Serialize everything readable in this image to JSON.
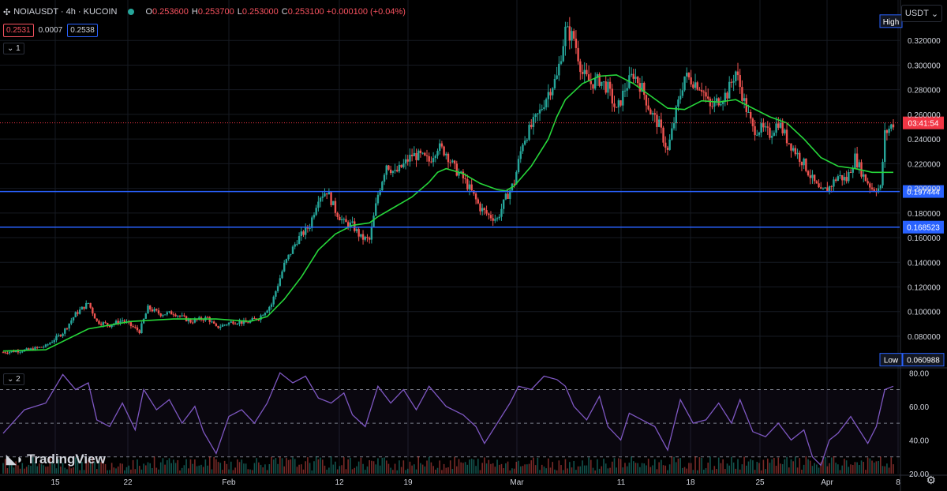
{
  "header": {
    "symbol": "NOIAUSDT · 4h · KUCOIN",
    "o_label": "O",
    "o_value": "0.253600",
    "h_label": "H",
    "h_value": "0.253700",
    "l_label": "L",
    "l_value": "0.253000",
    "c_label": "C",
    "c_value": "0.253100 +0.000100 (+0.04%)",
    "bid": "0.2531",
    "spread": "0.0007",
    "ask": "0.2538",
    "pane1_tag": "1",
    "pane2_tag": "2",
    "currency": "USDT",
    "brand": "TradingView"
  },
  "colors": {
    "up": "#26a69a",
    "down": "#ef5350",
    "ma": "#26d63a",
    "rsi": "#7e57c2",
    "hline": "#2962ff",
    "price_line": "#f23645"
  },
  "chart_data": [
    {
      "type": "line",
      "subtype": "candlestick",
      "ylim": [
        0.055,
        0.34
      ],
      "yticks": [
        "0.320000",
        "0.300000",
        "0.280000",
        "0.260000",
        "0.240000",
        "0.220000",
        "0.200000",
        "0.180000",
        "0.160000",
        "0.140000",
        "0.120000",
        "0.100000",
        "0.080000"
      ],
      "xticks": [
        "15",
        "22",
        "Feb",
        "12",
        "19",
        "Mar",
        "11",
        "18",
        "25",
        "Apr",
        "8"
      ],
      "price_path": [
        [
          0,
          0.067
        ],
        [
          6,
          0.069
        ],
        [
          10,
          0.072
        ],
        [
          14,
          0.083
        ],
        [
          17,
          0.098
        ],
        [
          20,
          0.107
        ],
        [
          22,
          0.092
        ],
        [
          25,
          0.089
        ],
        [
          28,
          0.093
        ],
        [
          32,
          0.084
        ],
        [
          34,
          0.103
        ],
        [
          37,
          0.098
        ],
        [
          40,
          0.099
        ],
        [
          44,
          0.092
        ],
        [
          48,
          0.095
        ],
        [
          50,
          0.087
        ],
        [
          54,
          0.092
        ],
        [
          57,
          0.091
        ],
        [
          60,
          0.095
        ],
        [
          63,
          0.106
        ],
        [
          66,
          0.138
        ],
        [
          69,
          0.158
        ],
        [
          72,
          0.17
        ],
        [
          74,
          0.193
        ],
        [
          76,
          0.198
        ],
        [
          78,
          0.182
        ],
        [
          80,
          0.172
        ],
        [
          82,
          0.17
        ],
        [
          84,
          0.16
        ],
        [
          86,
          0.158
        ],
        [
          88,
          0.195
        ],
        [
          90,
          0.22
        ],
        [
          92,
          0.212
        ],
        [
          94,
          0.219
        ],
        [
          96,
          0.227
        ],
        [
          98,
          0.226
        ],
        [
          100,
          0.222
        ],
        [
          102,
          0.234
        ],
        [
          104,
          0.229
        ],
        [
          106,
          0.216
        ],
        [
          108,
          0.208
        ],
        [
          110,
          0.197
        ],
        [
          112,
          0.184
        ],
        [
          114,
          0.178
        ],
        [
          116,
          0.175
        ],
        [
          118,
          0.192
        ],
        [
          120,
          0.205
        ],
        [
          122,
          0.238
        ],
        [
          124,
          0.25
        ],
        [
          126,
          0.262
        ],
        [
          128,
          0.278
        ],
        [
          130,
          0.29
        ],
        [
          132,
          0.328
        ],
        [
          134,
          0.322
        ],
        [
          136,
          0.293
        ],
        [
          138,
          0.285
        ],
        [
          140,
          0.288
        ],
        [
          142,
          0.281
        ],
        [
          144,
          0.262
        ],
        [
          146,
          0.281
        ],
        [
          148,
          0.293
        ],
        [
          150,
          0.281
        ],
        [
          152,
          0.262
        ],
        [
          154,
          0.251
        ],
        [
          156,
          0.23
        ],
        [
          158,
          0.262
        ],
        [
          160,
          0.291
        ],
        [
          162,
          0.287
        ],
        [
          164,
          0.282
        ],
        [
          166,
          0.265
        ],
        [
          168,
          0.272
        ],
        [
          170,
          0.277
        ],
        [
          172,
          0.295
        ],
        [
          174,
          0.27
        ],
        [
          176,
          0.248
        ],
        [
          178,
          0.248
        ],
        [
          180,
          0.244
        ],
        [
          182,
          0.254
        ],
        [
          184,
          0.24
        ],
        [
          186,
          0.23
        ],
        [
          188,
          0.22
        ],
        [
          190,
          0.207
        ],
        [
          192,
          0.196
        ],
        [
          194,
          0.201
        ],
        [
          196,
          0.21
        ],
        [
          198,
          0.207
        ],
        [
          200,
          0.225
        ],
        [
          202,
          0.21
        ],
        [
          204,
          0.2
        ],
        [
          206,
          0.2
        ],
        [
          207,
          0.244
        ],
        [
          209,
          0.253
        ]
      ],
      "ma_path": [
        [
          0,
          0.068
        ],
        [
          10,
          0.069
        ],
        [
          20,
          0.086
        ],
        [
          30,
          0.092
        ],
        [
          40,
          0.094
        ],
        [
          50,
          0.094
        ],
        [
          58,
          0.092
        ],
        [
          62,
          0.096
        ],
        [
          66,
          0.11
        ],
        [
          70,
          0.128
        ],
        [
          74,
          0.15
        ],
        [
          78,
          0.163
        ],
        [
          82,
          0.17
        ],
        [
          86,
          0.172
        ],
        [
          88,
          0.177
        ],
        [
          92,
          0.185
        ],
        [
          96,
          0.193
        ],
        [
          100,
          0.205
        ],
        [
          102,
          0.213
        ],
        [
          104,
          0.216
        ],
        [
          108,
          0.212
        ],
        [
          112,
          0.204
        ],
        [
          116,
          0.199
        ],
        [
          118,
          0.198
        ],
        [
          120,
          0.202
        ],
        [
          124,
          0.218
        ],
        [
          128,
          0.24
        ],
        [
          130,
          0.258
        ],
        [
          132,
          0.272
        ],
        [
          136,
          0.285
        ],
        [
          140,
          0.291
        ],
        [
          144,
          0.292
        ],
        [
          148,
          0.285
        ],
        [
          152,
          0.275
        ],
        [
          156,
          0.265
        ],
        [
          160,
          0.264
        ],
        [
          164,
          0.271
        ],
        [
          168,
          0.27
        ],
        [
          172,
          0.272
        ],
        [
          176,
          0.265
        ],
        [
          180,
          0.258
        ],
        [
          184,
          0.253
        ],
        [
          188,
          0.24
        ],
        [
          192,
          0.225
        ],
        [
          196,
          0.218
        ],
        [
          200,
          0.216
        ],
        [
          204,
          0.213
        ],
        [
          209,
          0.213
        ]
      ],
      "current_price": 0.2531,
      "countdown": "03:41:54",
      "hlines": [
        {
          "value": 0.197444,
          "label": "0.197444"
        },
        {
          "value": 0.168523,
          "label": "0.168523"
        }
      ],
      "high_label": "High",
      "high_value": 0.335,
      "low_label": "Low",
      "low_value": "0.060988",
      "low_value_num": 0.060988
    },
    {
      "type": "line",
      "subtype": "rsi",
      "ylim": [
        20,
        82
      ],
      "yticks": [
        "80.00",
        "60.00",
        "40.00",
        "20.00"
      ],
      "bands": [
        70,
        50,
        30
      ],
      "rsi_path": [
        [
          0,
          44
        ],
        [
          5,
          58
        ],
        [
          10,
          62
        ],
        [
          14,
          79
        ],
        [
          17,
          70
        ],
        [
          20,
          74
        ],
        [
          22,
          52
        ],
        [
          25,
          48
        ],
        [
          28,
          62
        ],
        [
          31,
          46
        ],
        [
          33,
          70
        ],
        [
          36,
          58
        ],
        [
          39,
          64
        ],
        [
          42,
          50
        ],
        [
          45,
          60
        ],
        [
          47,
          45
        ],
        [
          50,
          32
        ],
        [
          53,
          54
        ],
        [
          56,
          58
        ],
        [
          59,
          50
        ],
        [
          62,
          62
        ],
        [
          65,
          80
        ],
        [
          68,
          74
        ],
        [
          71,
          78
        ],
        [
          74,
          65
        ],
        [
          77,
          62
        ],
        [
          80,
          68
        ],
        [
          82,
          55
        ],
        [
          85,
          48
        ],
        [
          88,
          72
        ],
        [
          91,
          62
        ],
        [
          94,
          70
        ],
        [
          97,
          58
        ],
        [
          100,
          72
        ],
        [
          102,
          66
        ],
        [
          104,
          60
        ],
        [
          108,
          55
        ],
        [
          111,
          48
        ],
        [
          113,
          38
        ],
        [
          116,
          50
        ],
        [
          119,
          62
        ],
        [
          121,
          72
        ],
        [
          124,
          70
        ],
        [
          127,
          78
        ],
        [
          130,
          76
        ],
        [
          132,
          72
        ],
        [
          134,
          60
        ],
        [
          137,
          52
        ],
        [
          140,
          66
        ],
        [
          142,
          48
        ],
        [
          145,
          40
        ],
        [
          147,
          56
        ],
        [
          150,
          52
        ],
        [
          153,
          48
        ],
        [
          156,
          34
        ],
        [
          159,
          64
        ],
        [
          162,
          50
        ],
        [
          165,
          52
        ],
        [
          168,
          62
        ],
        [
          171,
          50
        ],
        [
          173,
          64
        ],
        [
          176,
          45
        ],
        [
          179,
          42
        ],
        [
          182,
          50
        ],
        [
          185,
          40
        ],
        [
          188,
          46
        ],
        [
          190,
          30
        ],
        [
          192,
          25
        ],
        [
          194,
          40
        ],
        [
          196,
          44
        ],
        [
          199,
          54
        ],
        [
          201,
          46
        ],
        [
          203,
          38
        ],
        [
          205,
          48
        ],
        [
          207,
          70
        ],
        [
          209,
          72
        ]
      ],
      "volume_note": ""
    }
  ]
}
